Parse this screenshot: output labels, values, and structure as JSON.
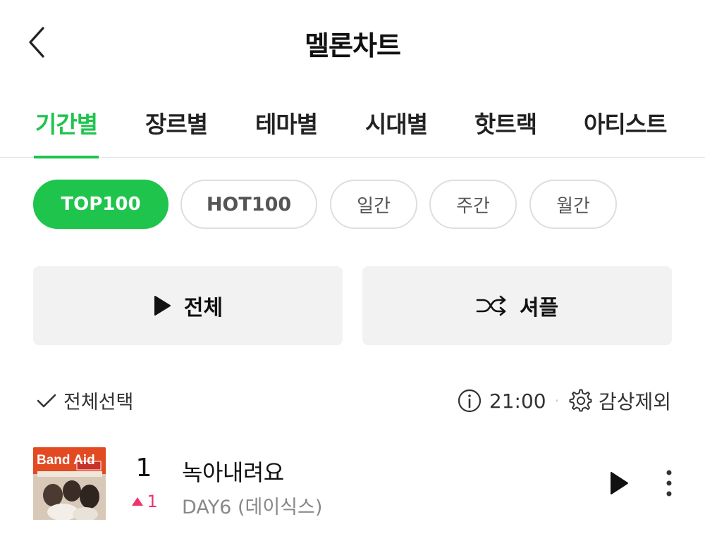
{
  "header": {
    "title": "멜론차트",
    "back_icon": "chevron-left-icon"
  },
  "tabs": [
    {
      "label": "기간별",
      "active": true
    },
    {
      "label": "장르별"
    },
    {
      "label": "테마별"
    },
    {
      "label": "시대별"
    },
    {
      "label": "핫트랙"
    },
    {
      "label": "아티스트"
    }
  ],
  "chips": [
    {
      "label": "TOP100",
      "active": true
    },
    {
      "label": "HOT100"
    },
    {
      "label": "일간"
    },
    {
      "label": "주간"
    },
    {
      "label": "월간"
    }
  ],
  "actions": {
    "play_all": {
      "label": "전체",
      "icon": "play-icon"
    },
    "shuffle": {
      "label": "셔플",
      "icon": "shuffle-icon"
    }
  },
  "toolbar": {
    "select_all": "전체선택",
    "time": "21:00",
    "separator": "·",
    "exclude": "감상제외"
  },
  "songs": [
    {
      "rank": "1",
      "change": "1",
      "change_direction": "up",
      "title": "녹아내려요",
      "artist": "DAY6 (데이식스)",
      "album_logo": "Band Aid"
    }
  ],
  "colors": {
    "accent": "#1ec44c",
    "rank_up": "#f0336b",
    "button_bg": "#f2f2f2"
  }
}
